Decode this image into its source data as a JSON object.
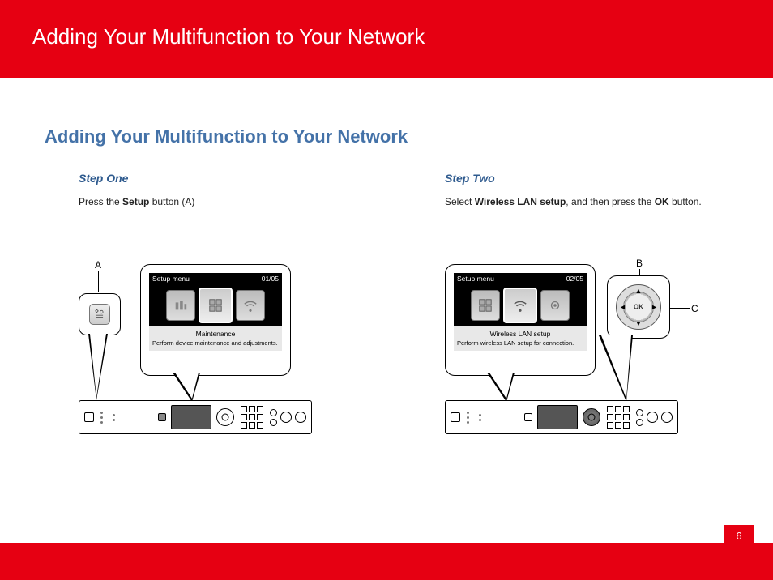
{
  "header": {
    "title": "Adding Your Multifunction to Your Network"
  },
  "section": {
    "heading": "Adding Your Multifunction to Your Network"
  },
  "step1": {
    "label": "Step One",
    "body_prefix": "Press the ",
    "body_bold": "Setup",
    "body_suffix": " button (A)",
    "callout_letter": "A",
    "lcd": {
      "menu_title": "Setup menu",
      "page_counter": "01/05",
      "selected_label": "Maintenance",
      "selected_desc": "Perform device maintenance and adjustments."
    }
  },
  "step2": {
    "label": "Step Two",
    "body_prefix": "Select ",
    "body_bold1": "Wireless LAN setup",
    "body_mid": ", and then press the ",
    "body_bold2": "OK",
    "body_suffix": " button.",
    "callout_letter_top": "B",
    "callout_letter_side": "C",
    "lcd": {
      "menu_title": "Setup menu",
      "page_counter": "02/05",
      "selected_label": "Wireless LAN setup",
      "selected_desc": "Perform wireless LAN setup for connection."
    },
    "wheel": {
      "ok_label": "OK"
    }
  },
  "footer": {
    "page_number": "6"
  }
}
